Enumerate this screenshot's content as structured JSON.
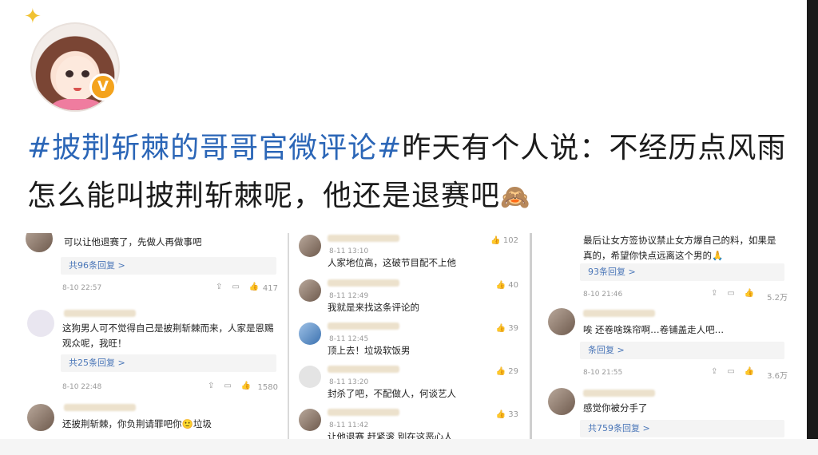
{
  "headline": {
    "hashtag": "#披荆斩棘的哥哥官微评论#",
    "text": "昨天有个人说：不经历点风雨怎么能叫披荆斩棘呢，他还是退赛吧",
    "emoji": "🙈"
  },
  "avatar": {
    "badge": "V"
  },
  "panel1": {
    "c1_text": "可以让他退赛了，先做人再做事吧",
    "c1_reply": "共96条回复 >",
    "c1_time": "8-10 22:57",
    "c1_like": "417",
    "c2_text": "这狗男人可不觉得自己是披荆斩棘而来，人家是恩赐观众呢，我旺！",
    "c2_reply": "共25条回复 >",
    "c2_time": "8-10 22:48",
    "c2_like": "1580",
    "c3_text": "还披荆斩棘，你负荆请罪吧你🙂垃圾"
  },
  "panel2": {
    "r1_time": "8-11 13:10",
    "r1_text": "人家地位高，这破节目配不上他",
    "r1_like": "102",
    "r2_time": "8-11 12:49",
    "r2_text": "我就是来找这条评论的",
    "r2_like": "40",
    "r3_time": "8-11 12:45",
    "r3_text": "顶上去！垃圾软饭男",
    "r3_like": "39",
    "r4_time": "8-11 13:20",
    "r4_text": "封杀了吧，不配做人，何谈艺人",
    "r4_like": "29",
    "r5_time": "8-11 11:42",
    "r5_text": "让他退赛 赶紧滚 别在这恶心人",
    "r5_like": "33"
  },
  "panel3": {
    "c1_text": "最后让女方签协议禁止女方爆自己的料，如果是真的，希望你快点远离这个男的🙏",
    "c1_reply": "93条回复 >",
    "c1_time": "8-10 21:46",
    "c1_like": "5.2万",
    "c2_text": "唉 还卷啥珠帘啊…卷铺盖走人吧…",
    "c2_reply": "条回复 >",
    "c2_time": "8-10 21:55",
    "c2_like": "3.6万",
    "c3_text": "感觉你被分手了",
    "c3_reply": "共759条回复 >"
  }
}
